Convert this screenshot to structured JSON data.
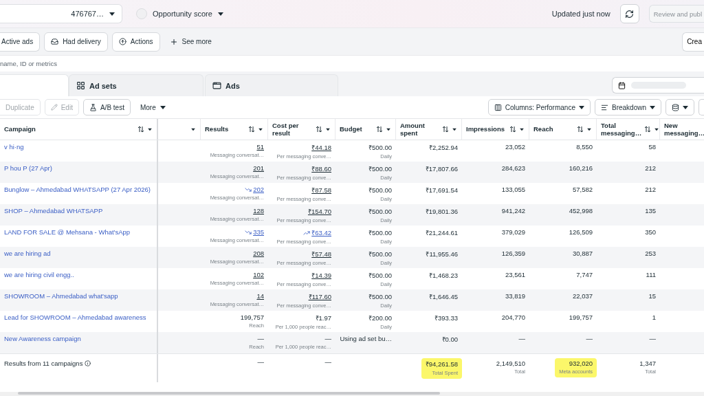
{
  "top_bar": {
    "account": "476767…",
    "opportunity_score": "Opportunity score",
    "updated": "Updated just now",
    "review_button": "Review and publ"
  },
  "filters": [
    {
      "label": "Active ads"
    },
    {
      "label": "Had delivery"
    },
    {
      "label": "Actions"
    }
  ],
  "see_more": "See more",
  "create_button": "Crea",
  "search": {
    "placeholder": "name, ID or metrics"
  },
  "tabs": [
    {
      "selected": true
    },
    {
      "label": "Ad sets",
      "selected": false
    },
    {
      "label": "Ads",
      "selected": false
    }
  ],
  "toolbar": {
    "left": [
      {
        "label": "Duplicate",
        "disabled": true
      },
      {
        "label": "Edit",
        "disabled": true
      },
      {
        "label": "A/B test",
        "disabled": false
      }
    ],
    "more": "More",
    "columns_button": "Columns: Performance",
    "breakdown_button": "Breakdown"
  },
  "table": {
    "columns": [
      {
        "label": "Campaign",
        "sortable": true
      },
      {
        "sortable": false
      },
      {
        "label": "Results",
        "sortable": true
      },
      {
        "label": "Cost per result",
        "sortable": true
      },
      {
        "label": "Budget",
        "sortable": true
      },
      {
        "label": "Amount spent",
        "sortable": true
      },
      {
        "label": "Impressions",
        "sortable": true
      },
      {
        "label": "Reach",
        "sortable": true
      },
      {
        "label": "Total messaging…",
        "sortable": true
      },
      {
        "label": "New messaging…"
      }
    ],
    "rows": [
      {
        "campaign": "v hi·ng",
        "results": {
          "value": "51",
          "sub": "Messaging conversat…",
          "linked": true,
          "falling": false
        },
        "cost": {
          "value": "₹44.18",
          "sub": "Per messaging conve…",
          "linked": true,
          "rising": false
        },
        "budget": {
          "value": "₹500.00",
          "sub": "Daily"
        },
        "amount": "₹2,252.94",
        "impressions": "23,052",
        "reach": "8,550",
        "total": "58"
      },
      {
        "campaign": "P hou P (27 Apr)",
        "results": {
          "value": "201",
          "sub": "Messaging conversat…",
          "linked": true,
          "falling": false
        },
        "cost": {
          "value": "₹88.60",
          "sub": "Per messaging conve…",
          "linked": true,
          "rising": false
        },
        "budget": {
          "value": "₹500.00",
          "sub": "Daily"
        },
        "amount": "₹17,807.66",
        "impressions": "284,623",
        "reach": "160,216",
        "total": "212"
      },
      {
        "campaign": "Bunglow – Ahmedabad WHATSAPP (27 Apr 2026)",
        "results": {
          "value": "202",
          "sub": "Messaging conversat…",
          "linked": true,
          "falling": true
        },
        "cost": {
          "value": "₹87.58",
          "sub": "Per messaging conve…",
          "linked": true,
          "rising": false
        },
        "budget": {
          "value": "₹500.00",
          "sub": "Daily"
        },
        "amount": "₹17,691.54",
        "impressions": "133,055",
        "reach": "57,582",
        "total": "212"
      },
      {
        "campaign": "SHOP – Ahmedabad WHATSAPP",
        "results": {
          "value": "128",
          "sub": "Messaging conversat…",
          "linked": true,
          "falling": false
        },
        "cost": {
          "value": "₹154.70",
          "sub": "Per messaging conve…",
          "linked": true,
          "rising": false
        },
        "budget": {
          "value": "₹500.00",
          "sub": "Daily"
        },
        "amount": "₹19,801.36",
        "impressions": "941,242",
        "reach": "452,998",
        "total": "135"
      },
      {
        "campaign": "LAND FOR SALE @ Mehsana - What'sApp",
        "results": {
          "value": "335",
          "sub": "Messaging conversat…",
          "linked": true,
          "falling": true
        },
        "cost": {
          "value": "₹63.42",
          "sub": "Per messaging conve…",
          "linked": true,
          "rising": true
        },
        "budget": {
          "value": "₹500.00",
          "sub": "Daily"
        },
        "amount": "₹21,244.61",
        "impressions": "379,029",
        "reach": "126,509",
        "total": "350"
      },
      {
        "campaign": "we are hiring ad",
        "results": {
          "value": "208",
          "sub": "Messaging conversat…",
          "linked": true,
          "falling": false
        },
        "cost": {
          "value": "₹57.48",
          "sub": "Per messaging conve…",
          "linked": true,
          "rising": false
        },
        "budget": {
          "value": "₹500.00",
          "sub": "Daily"
        },
        "amount": "₹11,955.46",
        "impressions": "126,359",
        "reach": "30,887",
        "total": "253"
      },
      {
        "campaign": "we are hiring civil engg..",
        "results": {
          "value": "102",
          "sub": "Messaging conversat…",
          "linked": true,
          "falling": false
        },
        "cost": {
          "value": "₹14.39",
          "sub": "Per messaging conve…",
          "linked": true,
          "rising": false
        },
        "budget": {
          "value": "₹500.00",
          "sub": "Daily"
        },
        "amount": "₹1,468.23",
        "impressions": "23,561",
        "reach": "7,747",
        "total": "111"
      },
      {
        "campaign": "SHOWROOM – Ahmedabad what'sapp",
        "results": {
          "value": "14",
          "sub": "Messaging conversat…",
          "linked": true,
          "falling": false
        },
        "cost": {
          "value": "₹117.60",
          "sub": "Per messaging conve…",
          "linked": true,
          "rising": false
        },
        "budget": {
          "value": "₹500.00",
          "sub": "Daily"
        },
        "amount": "₹1,646.45",
        "impressions": "33,819",
        "reach": "22,037",
        "total": "15"
      },
      {
        "campaign": "Lead for SHOWROOM – Ahmedabad awareness",
        "results": {
          "value": "199,757",
          "sub": "Reach",
          "linked": false,
          "falling": false
        },
        "cost": {
          "value": "₹1.97",
          "sub": "Per 1,000 people reac…",
          "linked": false,
          "rising": false
        },
        "budget": {
          "value": "₹200.00",
          "sub": "Daily"
        },
        "amount": "₹393.33",
        "impressions": "204,770",
        "reach": "199,757",
        "total": "1"
      },
      {
        "campaign": "New Awareness campaign",
        "results": {
          "value": "—",
          "sub": "Reach",
          "linked": false,
          "falling": false
        },
        "cost": {
          "value": "—",
          "sub": "Per 1,000 people reac…",
          "linked": false,
          "rising": false
        },
        "budget": {
          "value": "Using ad set bu…"
        },
        "amount": "₹0.00",
        "impressions": "—",
        "reach": "—",
        "total": "—"
      }
    ],
    "footer": {
      "label": "Results from 11 campaigns",
      "results": "—",
      "cost": "—",
      "amount": {
        "value": "₹94,261.58",
        "sub": "Total Spent",
        "highlighted": true
      },
      "impressions": {
        "value": "2,149,510",
        "sub": "Total",
        "highlighted": false
      },
      "reach": {
        "value": "932,020",
        "sub": "Meta accounts",
        "highlighted": true
      },
      "total": {
        "value": "1,347",
        "sub": "Total",
        "highlighted": false
      }
    }
  }
}
